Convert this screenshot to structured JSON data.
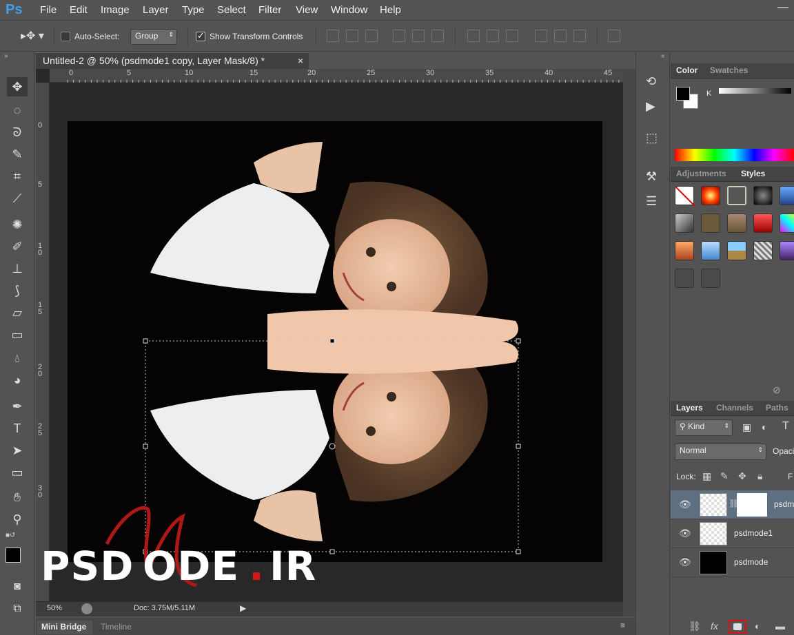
{
  "app": {
    "logo": "Ps"
  },
  "menu": [
    "File",
    "Edit",
    "Image",
    "Layer",
    "Type",
    "Select",
    "Filter",
    "View",
    "Window",
    "Help"
  ],
  "options": {
    "auto_select_label": "Auto-Select:",
    "auto_select_value": "Group",
    "show_transform_label": "Show Transform Controls"
  },
  "document": {
    "tab_title": "Untitled-2 @ 50% (psdmode1 copy, Layer Mask/8) *",
    "close": "×"
  },
  "ruler": {
    "h_labels": [
      "0",
      "5",
      "10",
      "15",
      "20",
      "25",
      "30",
      "35",
      "40",
      "45"
    ],
    "v_labels": [
      "0",
      "5",
      "1 0",
      "1 5",
      "2 0",
      "2 5",
      "3 0"
    ]
  },
  "status": {
    "zoom": "50%",
    "doc": "Doc: 3.75M/5.11M"
  },
  "bottom_tabs": [
    "Mini Bridge",
    "Timeline"
  ],
  "panels": {
    "color_tabs": [
      "Color",
      "Swatches"
    ],
    "color_k": "K",
    "adjust_tabs": [
      "Adjustments",
      "Styles"
    ],
    "layer_tabs": [
      "Layers",
      "Channels",
      "Paths"
    ],
    "kind": "Kind",
    "blend": "Normal",
    "opacity_label": "Opaci",
    "lock_label": "Lock:",
    "fill_label": "F",
    "layers": [
      {
        "name": "psdm"
      },
      {
        "name": "psdmode1"
      },
      {
        "name": "psdmode"
      }
    ]
  },
  "watermark": {
    "text_a": "PSD",
    "text_b": "ODE",
    "dot": ".",
    "text_c": "IR"
  },
  "colors": {
    "bg": "#535353",
    "canvas": "#050303",
    "accent": "#3fa0f0",
    "mask_highlight": "#e01010"
  }
}
